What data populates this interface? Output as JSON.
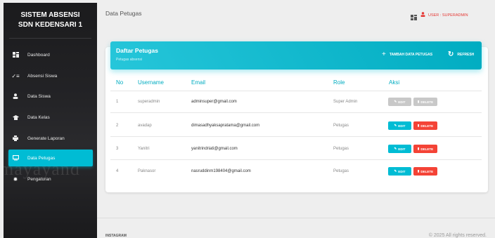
{
  "sidebar": {
    "brand_line1": "SISTEM ABSENSI",
    "brand_line2": "SDN KEDENSARI 1",
    "items": [
      {
        "label": "Dashboard",
        "icon": "dashboard-icon"
      },
      {
        "label": "Absensi Siswa",
        "icon": "checklist-icon"
      },
      {
        "label": "Data Siswa",
        "icon": "person-icon"
      },
      {
        "label": "Data Kelas",
        "icon": "school-icon"
      },
      {
        "label": "Generate Laporan",
        "icon": "print-icon"
      },
      {
        "label": "Data Petugas",
        "icon": "monitor-icon",
        "active": true
      },
      {
        "label": "Pengaturan",
        "icon": "gear-icon"
      }
    ]
  },
  "topbar": {
    "title": "Data Petugas",
    "user_label": "USER : SUPERADMIN"
  },
  "card": {
    "title": "Daftar Petugas",
    "subtitle": "Petugas absensi",
    "add_label": "TAMBAH DATA PETUGAS",
    "refresh_label": "REFRESH"
  },
  "table": {
    "headers": [
      "No",
      "Username",
      "Email",
      "Role",
      "Aksi"
    ],
    "edit_label": "EDIT",
    "delete_label": "DELETE",
    "rows": [
      {
        "no": "1",
        "username": "superadmin",
        "email": "adminsuper@gmail.com",
        "role": "Super Admin",
        "disabled": true
      },
      {
        "no": "2",
        "username": "avadap",
        "email": "dimasadhyaksapratama@gmail.com",
        "role": "Petugas",
        "disabled": false
      },
      {
        "no": "3",
        "username": "Yanitri",
        "email": "yanitrindriati@gmail.com",
        "role": "Petugas",
        "disabled": false
      },
      {
        "no": "4",
        "username": "Paknasor",
        "email": "nasruddinm198404@gmail.com",
        "role": "Petugas",
        "disabled": false
      }
    ]
  },
  "footer": {
    "left": "INSTAGRAM",
    "right": "© 2025 All rights reserved."
  },
  "colors": {
    "accent": "#00bcd4",
    "danger": "#f44336",
    "sidebar_bg": "#1b1b1d"
  }
}
